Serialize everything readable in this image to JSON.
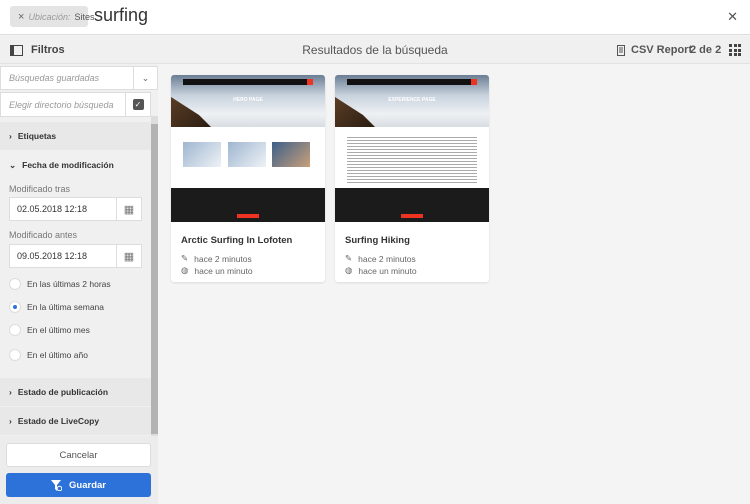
{
  "search": {
    "location_label": "Ubicación:",
    "location_value": "Sites",
    "query": "surfing",
    "close_icon": "close-icon"
  },
  "toolbar": {
    "filters_label": "Filtros",
    "title": "Resultados de la búsqueda",
    "csv_label": "CSV Report",
    "count": "2 de 2"
  },
  "sidebar": {
    "saved_searches_placeholder": "Búsquedas guardadas",
    "directory_placeholder": "Elegir directorio búsqueda",
    "tags_label": "Etiquetas",
    "modified_label": "Fecha de modificación",
    "after_label": "Modificado tras",
    "after_value": "02.05.2018 12:18",
    "before_label": "Modificado antes",
    "before_value": "09.05.2018 12:18",
    "radios": [
      {
        "label": "En las últimas 2 horas",
        "checked": false
      },
      {
        "label": "En la última semana",
        "checked": true
      },
      {
        "label": "En el último mes",
        "checked": false
      },
      {
        "label": "En el último año",
        "checked": false
      }
    ],
    "publish_label": "Estado de publicación",
    "livecopy_label": "Estado de LiveCopy",
    "cancel_label": "Cancelar",
    "save_label": "Guardar"
  },
  "results": [
    {
      "title": "Arctic Surfing In Lofoten",
      "hero": "HERO PAGE",
      "modified": "hace 2 minutos",
      "published": "hace un minuto"
    },
    {
      "title": "Surfing Hiking",
      "hero": "EXPERIENCE PAGE",
      "modified": "hace 2 minutos",
      "published": "hace un minuto"
    }
  ],
  "colors": {
    "accent": "#2d72d9",
    "brand_red": "#e32222"
  }
}
